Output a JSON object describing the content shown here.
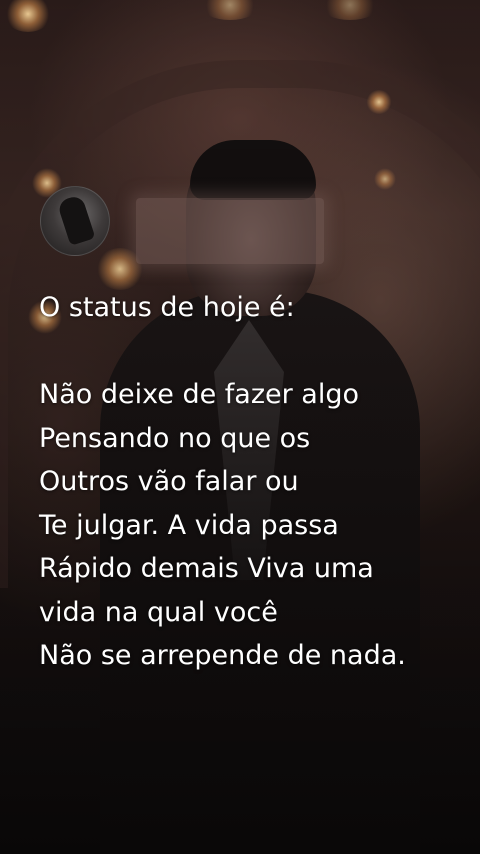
{
  "post": {
    "lines": [
      "O status de hoje é:",
      "",
      "Não deixe de fazer algo",
      "Pensando no que os",
      "Outros vão falar ou",
      "Te julgar. A vida passa",
      "Rápido demais Viva uma",
      "vida na qual você",
      "Não se arrepende de nada."
    ]
  }
}
